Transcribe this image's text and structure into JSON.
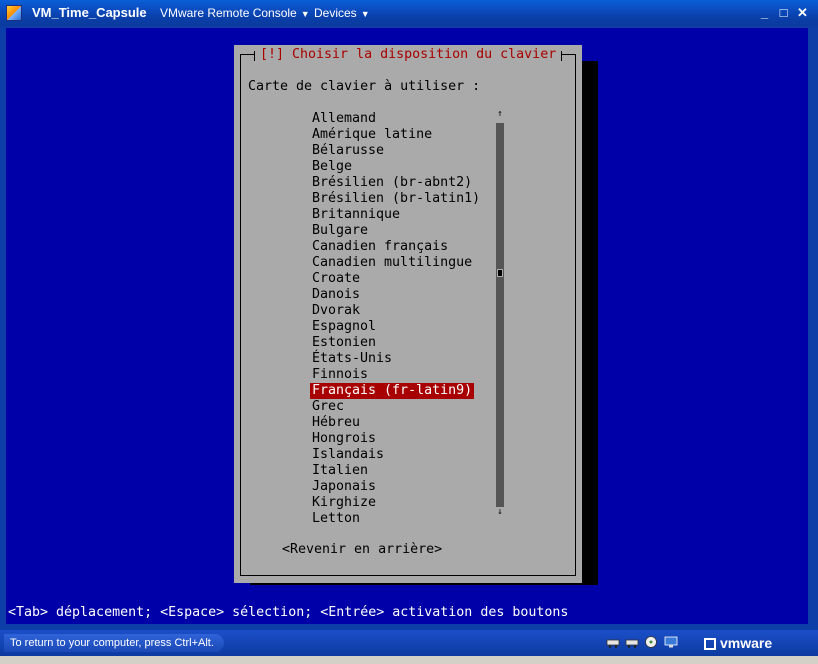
{
  "window": {
    "title": "VM_Time_Capsule",
    "menu_console": "VMware Remote Console",
    "menu_devices": "Devices",
    "minimize": "_",
    "maximize": "□",
    "close": "✕"
  },
  "dialog": {
    "title": "[!] Choisir la disposition du clavier",
    "prompt": "Carte de clavier à utiliser :",
    "items": [
      "Allemand",
      "Amérique latine",
      "Bélarusse",
      "Belge",
      "Brésilien (br-abnt2)",
      "Brésilien (br-latin1)",
      "Britannique",
      "Bulgare",
      "Canadien français",
      "Canadien multilingue",
      "Croate",
      "Danois",
      "Dvorak",
      "Espagnol",
      "Estonien",
      "États-Unis",
      "Finnois",
      "Français (fr-latin9)",
      "Grec",
      "Hébreu",
      "Hongrois",
      "Islandais",
      "Italien",
      "Japonais",
      "Kirghize",
      "Letton"
    ],
    "selected_index": 17,
    "scroll_up": "↑",
    "scroll_down": "↓",
    "back_button": "<Revenir en arrière>"
  },
  "help_line": "<Tab> déplacement; <Espace> sélection; <Entrée> activation des boutons",
  "statusbar": {
    "hint": "To return to your computer, press Ctrl+Alt.",
    "brand": "vmware",
    "device_icons": [
      "network-icon",
      "network-icon",
      "cdrom-icon",
      "display-icon"
    ]
  },
  "colors": {
    "console_bg": "#0000a8",
    "dialog_bg": "#aaaaaa",
    "title_red": "#a80000",
    "selection_bg": "#a80000"
  }
}
